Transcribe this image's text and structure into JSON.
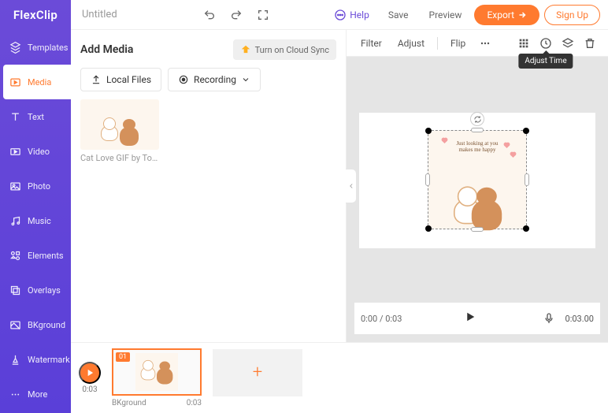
{
  "logo": "FlexClip",
  "sidebar": {
    "items": [
      {
        "label": "Templates"
      },
      {
        "label": "Media"
      },
      {
        "label": "Text"
      },
      {
        "label": "Video"
      },
      {
        "label": "Photo"
      },
      {
        "label": "Music"
      },
      {
        "label": "Elements"
      },
      {
        "label": "Overlays"
      },
      {
        "label": "BKground"
      },
      {
        "label": "Watermark"
      },
      {
        "label": "More"
      }
    ]
  },
  "topbar": {
    "title": "Untitled",
    "help": "Help",
    "save": "Save",
    "preview": "Preview",
    "export": "Export",
    "signup": "Sign Up"
  },
  "media_panel": {
    "title": "Add Media",
    "cloud_sync": "Turn on Cloud Sync",
    "local_files": "Local Files",
    "recording": "Recording",
    "item_caption": "Cat Love GIF by Tonton ..."
  },
  "stage_toolbar": {
    "filter": "Filter",
    "adjust": "Adjust",
    "flip": "Flip",
    "tooltip_adjust_time": "Adjust Time"
  },
  "canvas": {
    "text_line1": "Just looking at you",
    "text_line2": "makes me happy"
  },
  "playbar": {
    "time": "0:00 / 0:03",
    "duration": "0:03.00"
  },
  "timeline": {
    "time": "0:03",
    "clip_badge": "01",
    "clip_label": "BKground",
    "clip_duration": "0:03"
  }
}
